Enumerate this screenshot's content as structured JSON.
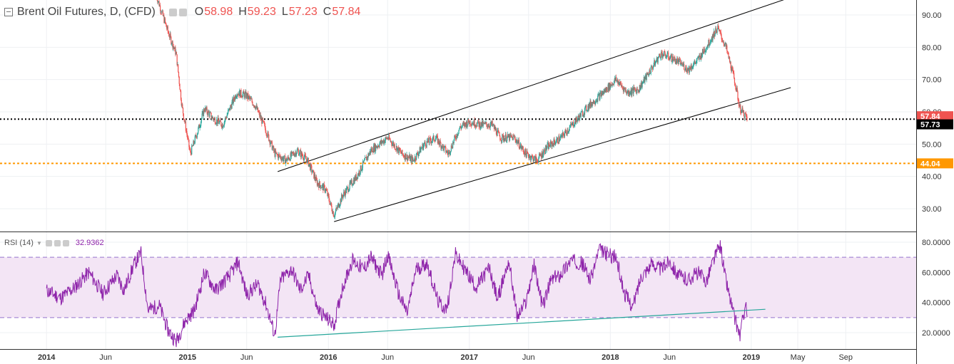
{
  "chart_data": [
    {
      "type": "candlestick",
      "title": "Brent Oil Futures, D, (CFD)",
      "ohlc": {
        "O_label": "O",
        "O": "58.98",
        "H_label": "H",
        "H": "59.23",
        "L_label": "L",
        "L": "57.23",
        "C_label": "C",
        "C": "57.84"
      },
      "x_ticks": [
        "2014",
        "Jun",
        "2015",
        "Jun",
        "2016",
        "Jun",
        "2017",
        "Jun",
        "2018",
        "Jun",
        "2019",
        "May",
        "Sep"
      ],
      "y_ticks": [
        "90.00",
        "80.00",
        "70.00",
        "60.00",
        "50.00",
        "40.00",
        "30.00"
      ],
      "ylim": [
        24,
        96
      ],
      "price_path": [
        [
          2014.78,
          96
        ],
        [
          2014.86,
          85
        ],
        [
          2014.92,
          78
        ],
        [
          2014.96,
          62
        ],
        [
          2015.02,
          47
        ],
        [
          2015.08,
          55
        ],
        [
          2015.12,
          61
        ],
        [
          2015.18,
          58
        ],
        [
          2015.25,
          56
        ],
        [
          2015.35,
          66
        ],
        [
          2015.42,
          65
        ],
        [
          2015.48,
          62
        ],
        [
          2015.55,
          55
        ],
        [
          2015.62,
          47
        ],
        [
          2015.7,
          45
        ],
        [
          2015.78,
          48
        ],
        [
          2015.85,
          45
        ],
        [
          2015.92,
          38
        ],
        [
          2015.98,
          36
        ],
        [
          2016.04,
          28
        ],
        [
          2016.1,
          34
        ],
        [
          2016.2,
          40
        ],
        [
          2016.3,
          48
        ],
        [
          2016.42,
          52
        ],
        [
          2016.52,
          47
        ],
        [
          2016.6,
          45
        ],
        [
          2016.68,
          50
        ],
        [
          2016.76,
          52
        ],
        [
          2016.85,
          47
        ],
        [
          2016.93,
          55
        ],
        [
          2017.0,
          57
        ],
        [
          2017.08,
          56
        ],
        [
          2017.16,
          56
        ],
        [
          2017.22,
          52
        ],
        [
          2017.32,
          52
        ],
        [
          2017.4,
          47
        ],
        [
          2017.48,
          45
        ],
        [
          2017.55,
          49
        ],
        [
          2017.65,
          52
        ],
        [
          2017.75,
          57
        ],
        [
          2017.85,
          62
        ],
        [
          2017.95,
          66
        ],
        [
          2018.04,
          70
        ],
        [
          2018.12,
          66
        ],
        [
          2018.2,
          67
        ],
        [
          2018.3,
          74
        ],
        [
          2018.36,
          78
        ],
        [
          2018.42,
          77
        ],
        [
          2018.5,
          75
        ],
        [
          2018.55,
          73
        ],
        [
          2018.62,
          76
        ],
        [
          2018.68,
          80
        ],
        [
          2018.76,
          86
        ],
        [
          2018.82,
          80
        ],
        [
          2018.88,
          70
        ],
        [
          2018.92,
          61
        ],
        [
          2018.97,
          58
        ]
      ],
      "last_price": 57.84,
      "last_price_label": "57.84",
      "dotted_level": 57.73,
      "dotted_level_label": "57.73",
      "support_level": 44.04,
      "support_label": "44.04",
      "channel_lines": [
        {
          "x": [
            2015.64,
            2019.25
          ],
          "y": [
            41.5,
            95
          ]
        },
        {
          "x": [
            2016.04,
            2019.28
          ],
          "y": [
            26,
            67.5
          ]
        }
      ],
      "colors": {
        "up": "#26a69a",
        "down": "#ef5350",
        "last_price_bg": "#ef5350",
        "support": "#ff9800",
        "dotted": "#000000"
      }
    },
    {
      "type": "line",
      "title": "RSI (14)",
      "value_label": "32.9362",
      "y_ticks": [
        "80.0000",
        "60.0000",
        "40.0000",
        "20.0000"
      ],
      "ylim": [
        10,
        85
      ],
      "band": [
        30,
        70
      ],
      "series_path": [
        [
          2014.0,
          48
        ],
        [
          2014.1,
          43
        ],
        [
          2014.2,
          50
        ],
        [
          2014.3,
          60
        ],
        [
          2014.4,
          46
        ],
        [
          2014.5,
          58
        ],
        [
          2014.55,
          48
        ],
        [
          2014.62,
          65
        ],
        [
          2014.67,
          73
        ],
        [
          2014.72,
          35
        ],
        [
          2014.8,
          38
        ],
        [
          2014.86,
          22
        ],
        [
          2014.92,
          14
        ],
        [
          2014.98,
          27
        ],
        [
          2015.05,
          35
        ],
        [
          2015.12,
          60
        ],
        [
          2015.2,
          48
        ],
        [
          2015.3,
          58
        ],
        [
          2015.36,
          67
        ],
        [
          2015.42,
          45
        ],
        [
          2015.5,
          52
        ],
        [
          2015.56,
          38
        ],
        [
          2015.62,
          18
        ],
        [
          2015.66,
          55
        ],
        [
          2015.74,
          62
        ],
        [
          2015.8,
          48
        ],
        [
          2015.86,
          58
        ],
        [
          2015.92,
          36
        ],
        [
          2015.98,
          30
        ],
        [
          2016.04,
          25
        ],
        [
          2016.1,
          50
        ],
        [
          2016.17,
          68
        ],
        [
          2016.25,
          62
        ],
        [
          2016.3,
          70
        ],
        [
          2016.38,
          58
        ],
        [
          2016.42,
          72
        ],
        [
          2016.5,
          45
        ],
        [
          2016.56,
          33
        ],
        [
          2016.62,
          62
        ],
        [
          2016.7,
          66
        ],
        [
          2016.78,
          40
        ],
        [
          2016.84,
          35
        ],
        [
          2016.9,
          72
        ],
        [
          2016.98,
          60
        ],
        [
          2017.05,
          50
        ],
        [
          2017.14,
          63
        ],
        [
          2017.2,
          42
        ],
        [
          2017.28,
          68
        ],
        [
          2017.34,
          30
        ],
        [
          2017.4,
          40
        ],
        [
          2017.46,
          65
        ],
        [
          2017.52,
          37
        ],
        [
          2017.58,
          55
        ],
        [
          2017.64,
          58
        ],
        [
          2017.72,
          68
        ],
        [
          2017.8,
          66
        ],
        [
          2017.86,
          55
        ],
        [
          2017.92,
          75
        ],
        [
          2017.98,
          72
        ],
        [
          2018.04,
          70
        ],
        [
          2018.1,
          46
        ],
        [
          2018.16,
          37
        ],
        [
          2018.22,
          58
        ],
        [
          2018.3,
          66
        ],
        [
          2018.36,
          62
        ],
        [
          2018.42,
          68
        ],
        [
          2018.48,
          58
        ],
        [
          2018.55,
          55
        ],
        [
          2018.62,
          60
        ],
        [
          2018.68,
          54
        ],
        [
          2018.73,
          68
        ],
        [
          2018.78,
          78
        ],
        [
          2018.82,
          55
        ],
        [
          2018.88,
          30
        ],
        [
          2018.92,
          18
        ],
        [
          2018.96,
          40
        ],
        [
          2018.97,
          33
        ]
      ],
      "trend_line": {
        "x": [
          2015.64,
          2019.1
        ],
        "y": [
          17,
          35.5
        ]
      },
      "colors": {
        "line": "#8e24aa",
        "band": "#f3e5f5",
        "trend": "#26a69a"
      }
    }
  ]
}
